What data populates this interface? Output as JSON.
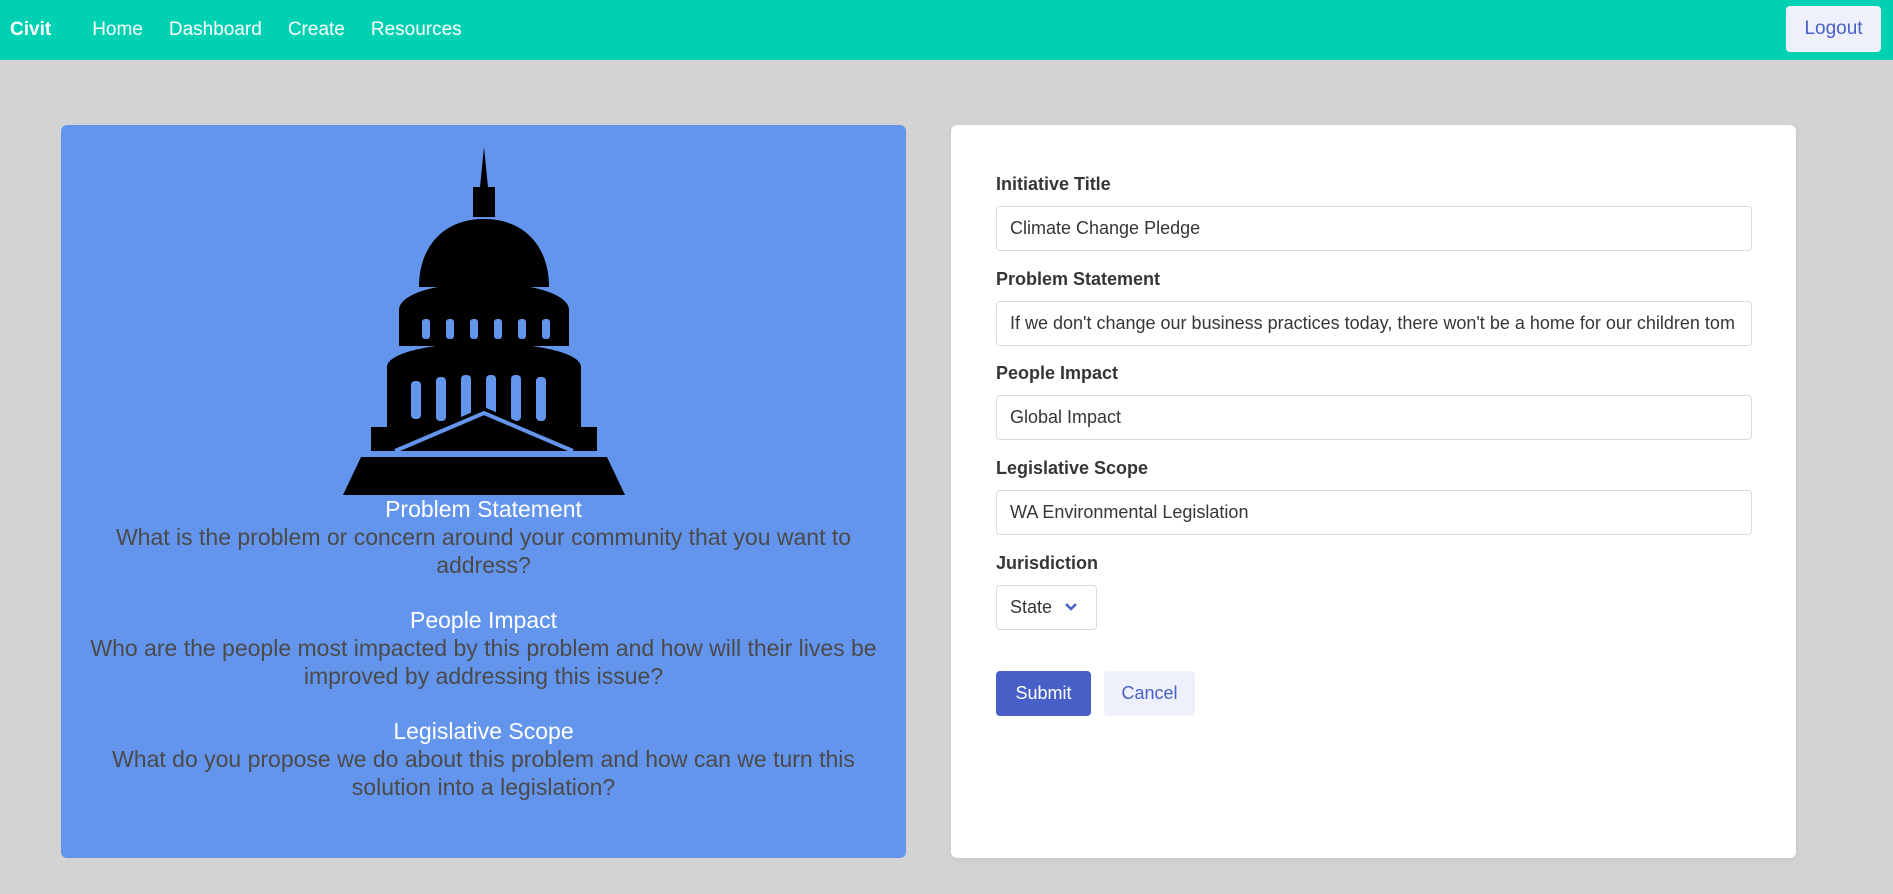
{
  "navbar": {
    "brand": "Civit",
    "items": [
      {
        "label": "Home"
      },
      {
        "label": "Dashboard"
      },
      {
        "label": "Create"
      },
      {
        "label": "Resources"
      }
    ],
    "logout_label": "Logout",
    "background_color": "#00d1b2"
  },
  "info_card": {
    "background_color": "#6495ed",
    "icon": "capitol-building-icon",
    "sections": [
      {
        "title": "Problem Statement",
        "text": "What is the problem or concern around your community that you want to address?"
      },
      {
        "title": "People Impact",
        "text": "Who are the people most impacted by this problem and how will their lives be improved by addressing this issue?"
      },
      {
        "title": "Legislative Scope",
        "text": "What do you propose we do about this problem and how can we turn this solution into a legislation?"
      }
    ]
  },
  "form": {
    "fields": [
      {
        "label": "Initiative Title",
        "value": "Climate Change Pledge"
      },
      {
        "label": "Problem Statement",
        "value": "If we don't change our business practices today, there won't be a home for our children tom"
      },
      {
        "label": "People Impact",
        "value": "Global Impact"
      },
      {
        "label": "Legislative Scope",
        "value": "WA Environmental Legislation"
      }
    ],
    "jurisdiction": {
      "label": "Jurisdiction",
      "selected": "State"
    },
    "submit_label": "Submit",
    "cancel_label": "Cancel",
    "accent_color": "#485fc7"
  }
}
